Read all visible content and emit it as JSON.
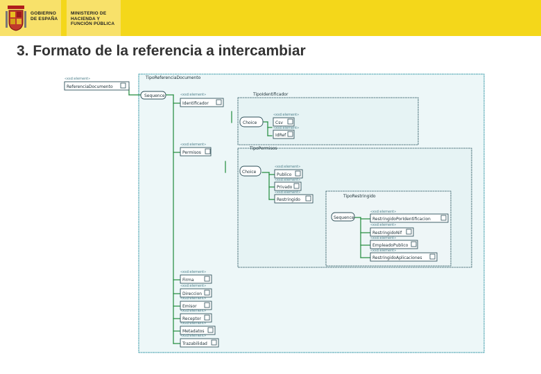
{
  "header": {
    "government": "GOBIERNO DE ESPAÑA",
    "ministry": "MINISTERIO DE HACIENDA Y FUNCIÓN PÚBLICA"
  },
  "slide": {
    "title": "3. Formato de la referencia a intercambiar"
  },
  "schema": {
    "root": {
      "stereotype": "«xsd:element»",
      "name": "ReferenciaDocumento"
    },
    "root_type": "TipoReferenciaDocumento",
    "root_sequence": "Sequence",
    "identificador": {
      "stereotype": "«xsd:element»",
      "name": "Identificador"
    },
    "identificador_type": "TipoIdentificador",
    "identificador_choice": "Choice",
    "csv": {
      "stereotype": "«xsd:element»",
      "name": "Csv"
    },
    "idref": {
      "stereotype": "«xsd:element»",
      "name": "IdRef"
    },
    "permisos": {
      "stereotype": "«xsd:element»",
      "name": "Permisos"
    },
    "permisos_type": "TipoPermisos",
    "permisos_choice": "Choice",
    "publico": {
      "stereotype": "«xsd:element»",
      "name": "Publico"
    },
    "privado": {
      "stereotype": "«xsd:element»",
      "name": "Privado"
    },
    "restringido": {
      "stereotype": "«xsd:element»",
      "name": "Restringido"
    },
    "restringido_type": "TipoRestringido",
    "restringido_sequence": "Sequence",
    "r_identificacion": {
      "stereotype": "«xsd:element»",
      "name": "RestringidoPorIdentificacion"
    },
    "r_nif": {
      "stereotype": "«xsd:element»",
      "name": "RestringidoNif"
    },
    "empleado": {
      "stereotype": "«xsd:element»",
      "name": "EmpleadoPublico"
    },
    "r_aplicaciones": {
      "stereotype": "«xsd:element»",
      "name": "RestringidoAplicaciones"
    },
    "firma": {
      "stereotype": "«xsd:element»",
      "name": "Firma"
    },
    "direccion": {
      "stereotype": "«xsd:element»",
      "name": "Direccion"
    },
    "emisor": {
      "stereotype": "«xsd:element»",
      "name": "Emisor"
    },
    "receptor": {
      "stereotype": "«xsd:element»",
      "name": "Receptor"
    },
    "metadatos": {
      "stereotype": "«xsd:element»",
      "name": "Metadatos"
    },
    "trazabilidad": {
      "stereotype": "«xsd:element»",
      "name": "Trazabilidad"
    }
  }
}
